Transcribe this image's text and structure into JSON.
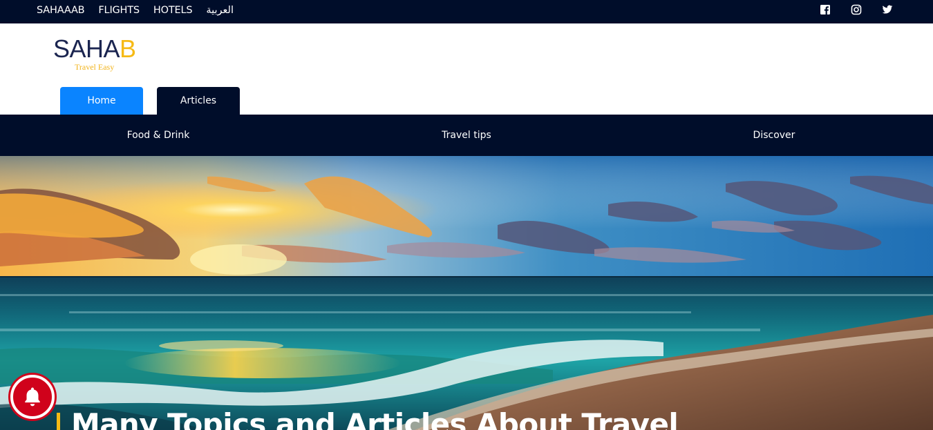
{
  "top_nav": {
    "links": [
      "SAHAAAB",
      "FLIGHTS",
      "HOTELS",
      "العربية"
    ],
    "social_icons": [
      "facebook-icon",
      "instagram-icon",
      "twitter-icon"
    ]
  },
  "logo": {
    "text": "SAHAB",
    "text_main": "SAHA",
    "text_accent": "B",
    "tagline": "Travel Easy",
    "colors": {
      "main": "#1b2550",
      "accent": "#f6ba15"
    }
  },
  "tabs": [
    {
      "label": "Home",
      "active": true,
      "color": "#0a84ff"
    },
    {
      "label": "Articles",
      "active": false,
      "color": "#000d2a"
    }
  ],
  "categories": [
    "Food & Drink",
    "Travel tips",
    "Discover"
  ],
  "hero": {
    "title": "Many Topics and Articles About Travel"
  },
  "notification": {
    "icon": "bell-icon",
    "color": "#d0021b"
  },
  "colors": {
    "navy": "#000d2a",
    "blue": "#0a84ff",
    "yellow": "#f6ba15"
  }
}
